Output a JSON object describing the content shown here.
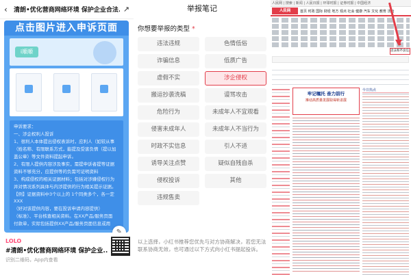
{
  "phone": {
    "title": "清朗•优化营商网络环境 保护企业合法...",
    "banner": "点击图片进入申诉页面",
    "mini_logo": "i顺顺",
    "requirements": [
      "申诉要求：",
      "一、涉企权利人投诉",
      "1、很利人本体提出侵权表诉时，应利人（如较从事",
      "（姓名称、有限联系方式，能提及受害负情（提以加",
      "盖公章）等文件资料提起申诉。",
      "2、有限人提供内容涉及事实，需提申诉者提等证据",
      "资料不够充分，应提供等的负需可证明资料",
      "3、构成侵权的相关证据材料；包括对涉嫌侵权行为",
      "并对情况系列具体与内涉提供的行为相关提示证据。",
      "【例】证据资料中3个以上的 1个同类多个，各一定XXX",
      "（好对该提供内容，要在投诉申请内容提供）",
      "（标准）、平台核查相关资料。在XX产品/服务页面",
      "付款单，实际包括提供XX产品/服务页面信息或用"
    ],
    "brand": "LOLO",
    "footer_name": "#清朗•优化营商网络环境 保护企业...",
    "footer_hint": "识别二维码，App内查看"
  },
  "report": {
    "title": "举报笔记",
    "question": "你想要举报的类型",
    "required_mark": "*",
    "options": [
      {
        "label": "违法违规",
        "selected": false
      },
      {
        "label": "色情低俗",
        "selected": false
      },
      {
        "label": "诈骗信息",
        "selected": false
      },
      {
        "label": "低质广告",
        "selected": false
      },
      {
        "label": "虚假不实",
        "selected": false
      },
      {
        "label": "涉企侵权",
        "selected": true
      },
      {
        "label": "搬运抄袭洗稿",
        "selected": false
      },
      {
        "label": "谩骂攻击",
        "selected": false
      },
      {
        "label": "危险行为",
        "selected": false
      },
      {
        "label": "未成年人不宜观看",
        "selected": false
      },
      {
        "label": "侵害未成年人",
        "selected": false
      },
      {
        "label": "未成年人不当行为",
        "selected": false
      },
      {
        "label": "时政不实信息",
        "selected": false
      },
      {
        "label": "引人不适",
        "selected": false
      },
      {
        "label": "诱导关注点赞",
        "selected": false
      },
      {
        "label": "疑似自残自杀",
        "selected": false
      },
      {
        "label": "侵权投诉",
        "selected": false
      },
      {
        "label": "其他",
        "selected": false
      },
      {
        "label": "违规售卖",
        "selected": false
      }
    ],
    "note": "以上选择，小红书推荐您优先与对方协商解决，若您无法联系协商无效，也可通过以下方式向小红书提起投诉。"
  },
  "portal": {
    "topstrip": "人民网 | 搜索 | 新闻 | 人民日报 | 环球时报 | 证券时报 | 中国经济",
    "logo": "人民网",
    "nav_links": "首页 时政 国际 财经 地方 观点 社会 健康 汽车 文化 教育 法治",
    "report_link": "违法和不良信息举报",
    "headline": "牢记嘱托 奋力前行",
    "headline_sub": "推动高质量发展取得新进展",
    "side_header": "今日热点"
  }
}
